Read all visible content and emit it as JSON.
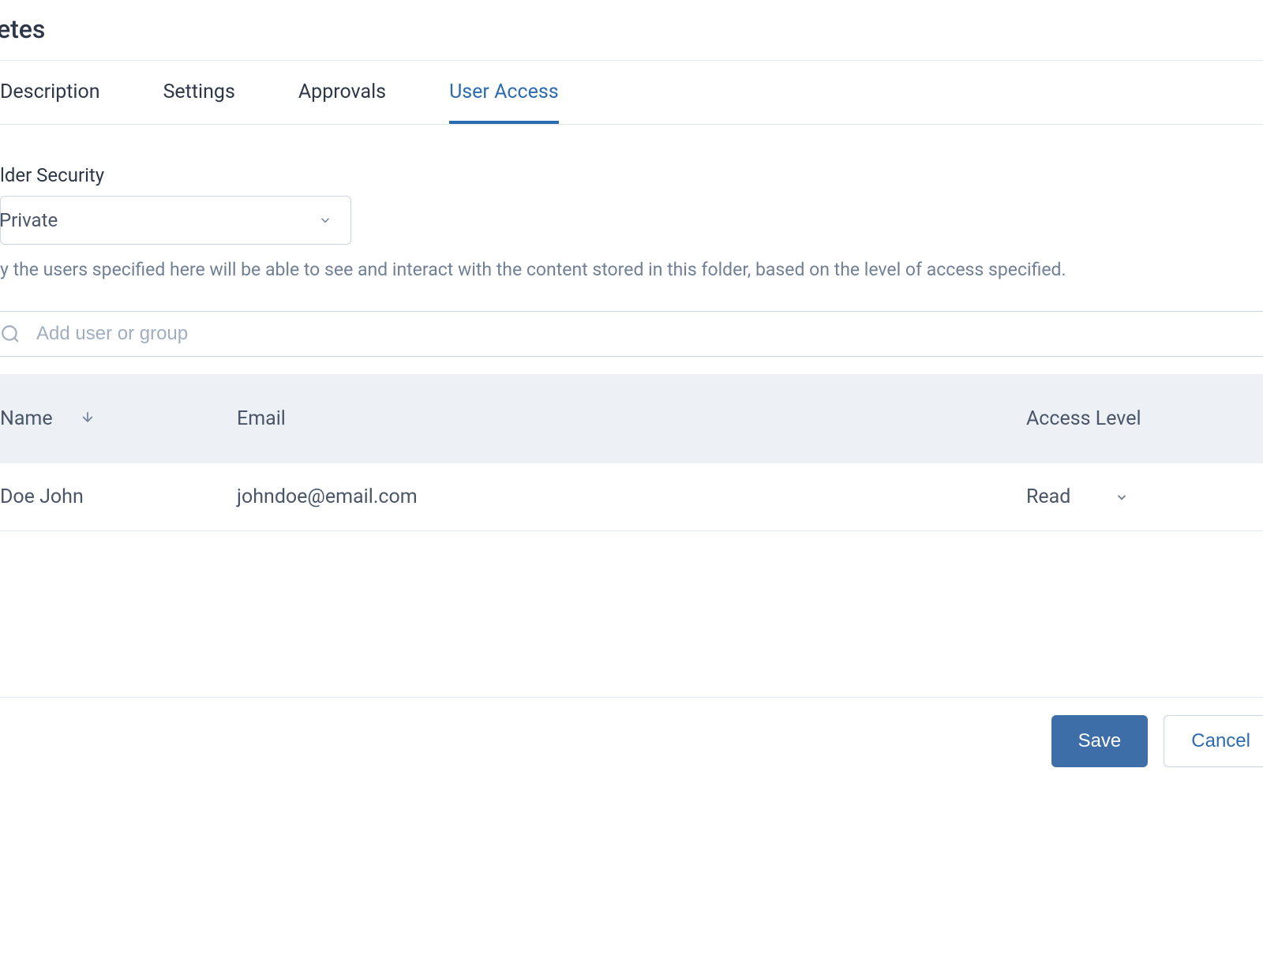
{
  "header": {
    "title": "hletes"
  },
  "tabs": [
    {
      "label": "Description",
      "active": false
    },
    {
      "label": "Settings",
      "active": false
    },
    {
      "label": "Approvals",
      "active": false
    },
    {
      "label": "User Access",
      "active": true
    }
  ],
  "folder_security": {
    "label": "lder Security",
    "value": "Private",
    "helper": "y the users specified here will be able to see and interact with the content stored in this folder, based on the level of access specified."
  },
  "search": {
    "placeholder": "Add user or group"
  },
  "table": {
    "columns": {
      "name": "Name",
      "email": "Email",
      "access_level": "Access Level"
    },
    "rows": [
      {
        "name": "Doe John",
        "email": "johndoe@email.com",
        "access_level": "Read"
      }
    ]
  },
  "footer": {
    "save_label": "Save",
    "cancel_label": "Cancel"
  }
}
